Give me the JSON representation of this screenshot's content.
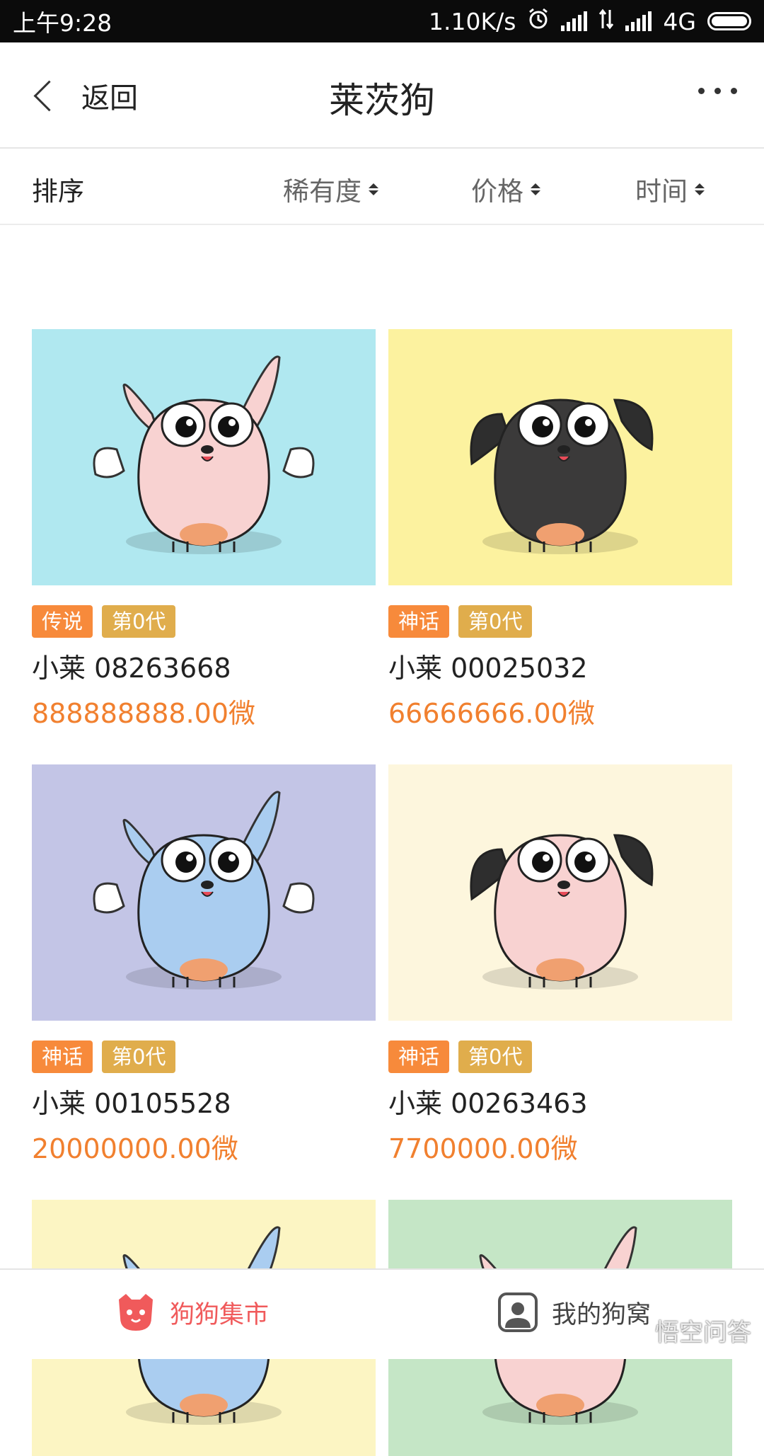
{
  "status_bar": {
    "time": "上午9:28",
    "net_speed": "1.10K/s",
    "network": "4G",
    "icons": [
      "alarm-icon",
      "signal-icon",
      "data-arrows-icon",
      "signal-icon",
      "battery-icon"
    ]
  },
  "header": {
    "back_label": "返回",
    "title": "莱茨狗",
    "more_icon": "more-dots-icon"
  },
  "sort_bar": {
    "label": "排序",
    "options": [
      {
        "label": "稀有度"
      },
      {
        "label": "价格"
      },
      {
        "label": "时间"
      }
    ]
  },
  "cards": [
    {
      "rarity": "传说",
      "generation": "第0代",
      "name": "小莱 08263668",
      "price": "888888888.00微",
      "bg": "#b0e8f0",
      "body": "#f8d2d1",
      "ears": "pink",
      "winged": true
    },
    {
      "rarity": "神话",
      "generation": "第0代",
      "name": "小莱 00025032",
      "price": "66666666.00微",
      "bg": "#fcf29f",
      "body": "#3b3a3a",
      "ears": "black",
      "winged": false
    },
    {
      "rarity": "神话",
      "generation": "第0代",
      "name": "小莱 00105528",
      "price": "20000000.00微",
      "bg": "#c3c5e6",
      "body": "#aacdf0",
      "ears": "blue",
      "winged": true
    },
    {
      "rarity": "神话",
      "generation": "第0代",
      "name": "小莱 00263463",
      "price": "7700000.00微",
      "bg": "#fdf6dd",
      "body": "#f8d2d1",
      "ears": "black",
      "winged": false
    },
    {
      "bg": "#fcf5c3",
      "body": "#aacdf0"
    },
    {
      "bg": "#c5e6c6",
      "body": "#f8d2d1"
    }
  ],
  "tab_bar": {
    "market_label": "狗狗集市",
    "kennel_label": "我的狗窝",
    "active_color": "#f05a5b"
  },
  "watermark": "悟空问答"
}
